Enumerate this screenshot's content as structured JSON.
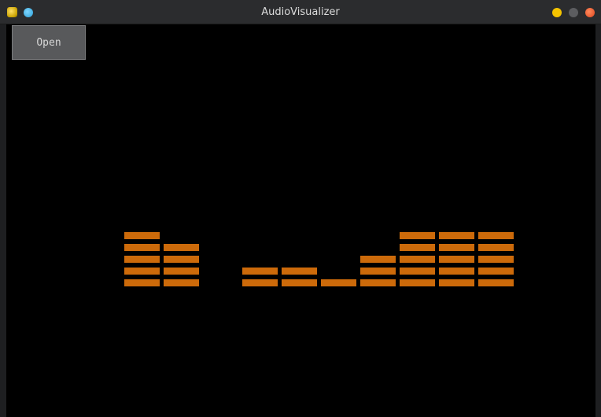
{
  "window": {
    "title": "AudioVisualizer"
  },
  "toolbar": {
    "open_label": "Open"
  },
  "colors": {
    "bar": "#cc6a0a",
    "background": "#000000"
  },
  "chart_data": {
    "type": "bar",
    "segment_counts": [
      5,
      4,
      0,
      2,
      2,
      1,
      3,
      5,
      5,
      5
    ],
    "max_segments": 5
  }
}
